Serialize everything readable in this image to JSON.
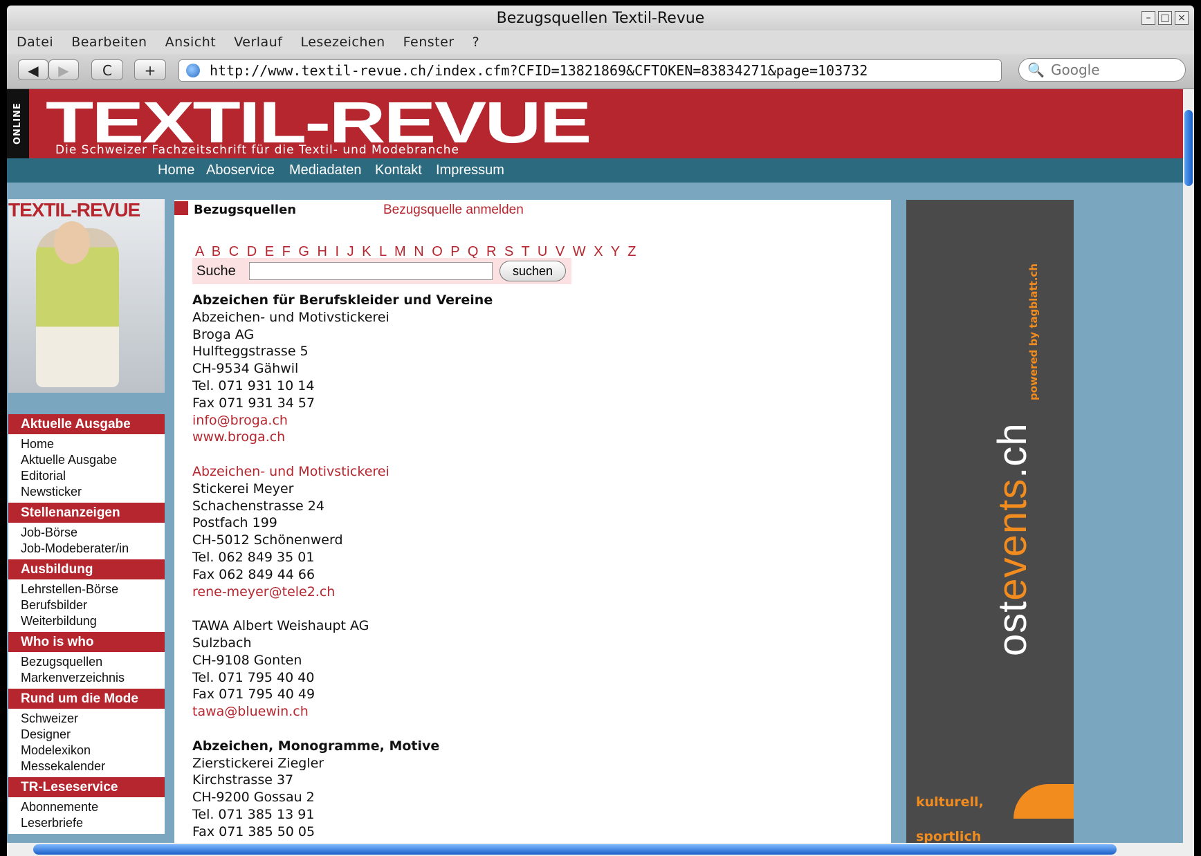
{
  "window": {
    "title": "Bezugsquellen Textil-Revue"
  },
  "menu": [
    "Datei",
    "Bearbeiten",
    "Ansicht",
    "Verlauf",
    "Lesezeichen",
    "Fenster",
    "?"
  ],
  "toolbar": {
    "back": "◀",
    "forward": "▶",
    "reload": "C",
    "new_tab": "+",
    "url": "http://www.textil-revue.ch/index.cfm?CFID=13821869&CFTOKEN=83834271&page=103732",
    "search_placeholder": "Google"
  },
  "site": {
    "online_label": "ONLINE",
    "logo": "TEXTIL-REVUE",
    "tagline": "Die Schweizer Fachzeitschrift für die Textil- und Modebranche",
    "nav": [
      "Home",
      "Aboservice",
      "Mediadaten",
      "Kontakt",
      "Impressum"
    ],
    "cover_title": "TEXTIL-REVUE"
  },
  "sidebar": [
    {
      "title": "Aktuelle Ausgabe",
      "items": [
        "Home",
        "Aktuelle Ausgabe",
        "Editorial",
        "Newsticker"
      ]
    },
    {
      "title": "Stellenanzeigen",
      "items": [
        "Job-Börse",
        "Job-Modeberater/in"
      ]
    },
    {
      "title": "Ausbildung",
      "items": [
        "Lehrstellen-Börse",
        "Berufsbilder",
        "Weiterbildung"
      ]
    },
    {
      "title": "Who is who",
      "items": [
        "Bezugsquellen",
        "Markenverzeichnis"
      ]
    },
    {
      "title": "Rund um die Mode",
      "items": [
        "Schweizer",
        "Designer",
        "Modelexikon",
        "Messekalender"
      ]
    },
    {
      "title": "TR-Leseservice",
      "items": [
        "Abonnemente",
        "Leserbriefe"
      ]
    }
  ],
  "content": {
    "heading": "Bezugsquellen",
    "register_link": "Bezugsquelle anmelden",
    "alphabet": "A B C D E F G H I J K L M N O P Q R S T U V W X Y Z",
    "search_label": "Suche",
    "search_button": "suchen",
    "listing": [
      {
        "type": "h",
        "text": "Abzeichen für Berufskleider und Vereine"
      },
      {
        "type": "t",
        "text": "Abzeichen- und Motivstickerei"
      },
      {
        "type": "t",
        "text": "Broga AG"
      },
      {
        "type": "t",
        "text": "Hulfteggstrasse 5"
      },
      {
        "type": "t",
        "text": "CH-9534 Gähwil"
      },
      {
        "type": "t",
        "text": "Tel. 071 931 10 14"
      },
      {
        "type": "t",
        "text": "Fax 071 931 34 57"
      },
      {
        "type": "link",
        "text": "info@broga.ch"
      },
      {
        "type": "link",
        "text": "www.broga.ch"
      },
      {
        "type": "gap",
        "text": ""
      },
      {
        "type": "link",
        "text": "Abzeichen- und Motivstickerei"
      },
      {
        "type": "t",
        "text": "Stickerei Meyer"
      },
      {
        "type": "t",
        "text": "Schachenstrasse 24"
      },
      {
        "type": "t",
        "text": "Postfach 199"
      },
      {
        "type": "t",
        "text": "CH-5012 Schönenwerd"
      },
      {
        "type": "t",
        "text": "Tel. 062 849 35 01"
      },
      {
        "type": "t",
        "text": "Fax 062 849 44 66"
      },
      {
        "type": "link",
        "text": "rene-meyer@tele2.ch"
      },
      {
        "type": "gap",
        "text": ""
      },
      {
        "type": "t",
        "text": "TAWA Albert Weishaupt AG"
      },
      {
        "type": "t",
        "text": "Sulzbach"
      },
      {
        "type": "t",
        "text": "CH-9108 Gonten"
      },
      {
        "type": "t",
        "text": "Tel. 071 795 40 40"
      },
      {
        "type": "t",
        "text": "Fax 071 795 40 49"
      },
      {
        "type": "link",
        "text": "tawa@bluewin.ch"
      },
      {
        "type": "gap",
        "text": ""
      },
      {
        "type": "h",
        "text": "Abzeichen, Monogramme, Motive"
      },
      {
        "type": "t",
        "text": "Zierstickerei Ziegler"
      },
      {
        "type": "t",
        "text": "Kirchstrasse 37"
      },
      {
        "type": "t",
        "text": "CH-9200 Gossau 2"
      },
      {
        "type": "t",
        "text": "Tel. 071 385 13 91"
      },
      {
        "type": "t",
        "text": "Fax 071 385 50 05"
      }
    ]
  },
  "ad": {
    "brand_pre": "ost",
    "brand_mid": "events",
    "brand_post": ".ch",
    "powered": "powered by tagblatt.ch",
    "line1": "kulturell,",
    "line2": "sportlich"
  }
}
